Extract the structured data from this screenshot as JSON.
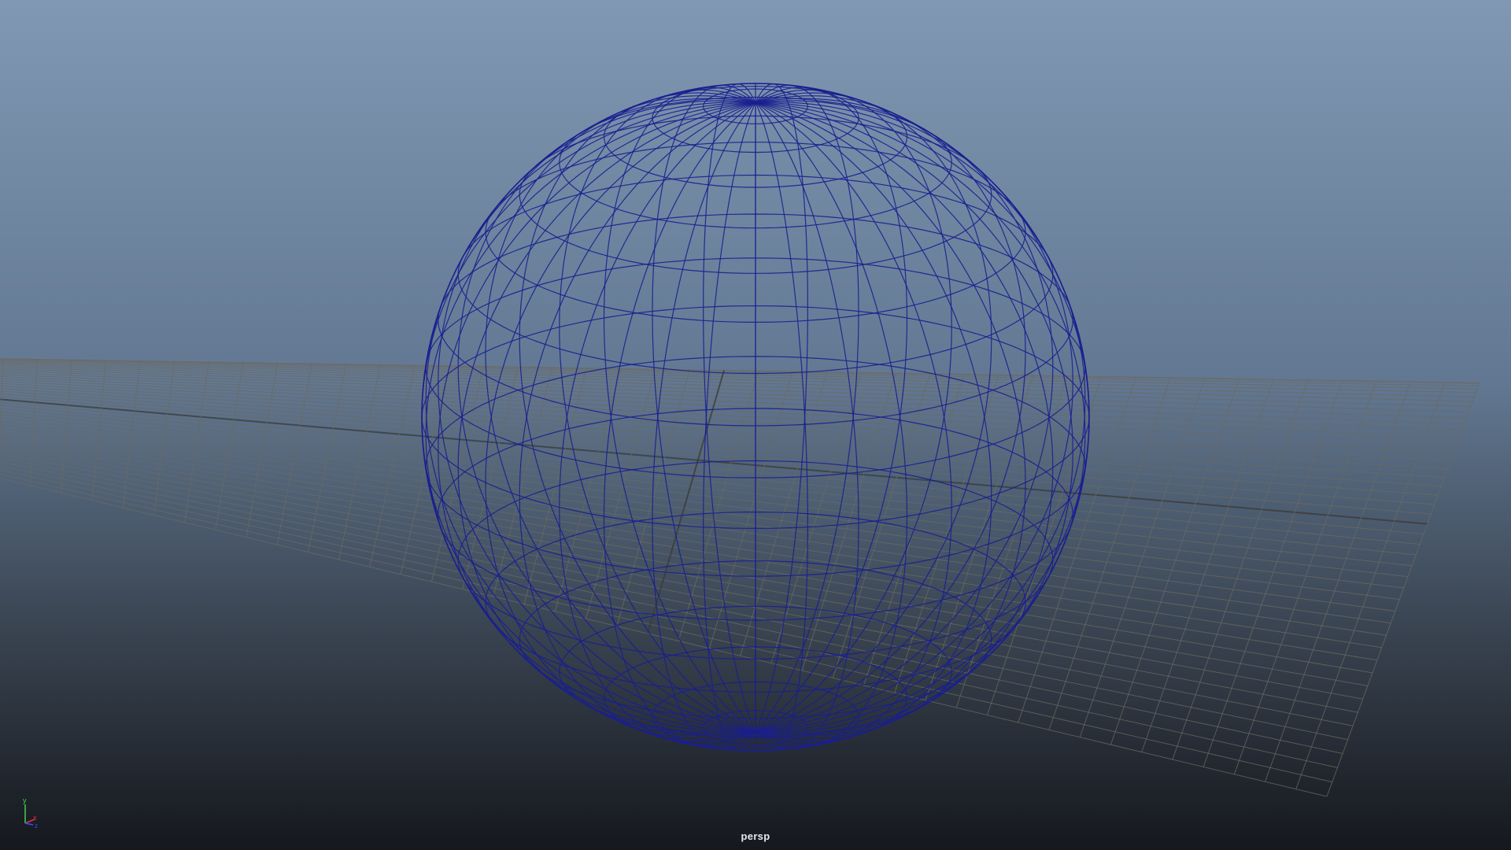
{
  "viewport": {
    "camera_label": "persp",
    "background_top": "#8098b3",
    "background_bottom": "#15181d",
    "wireframe_color": "#1a1f8f",
    "grid_color": "#6b6a63",
    "grid_axis_color": "#3b3a36"
  },
  "axis_gizmo": {
    "y_label": "y",
    "x_label": "x",
    "z_label": "z",
    "y_color": "#3fd14a",
    "x_color": "#e0323a",
    "z_color": "#3650ff"
  },
  "icons": {
    "axis_gizmo": "axis-gizmo-icon"
  }
}
